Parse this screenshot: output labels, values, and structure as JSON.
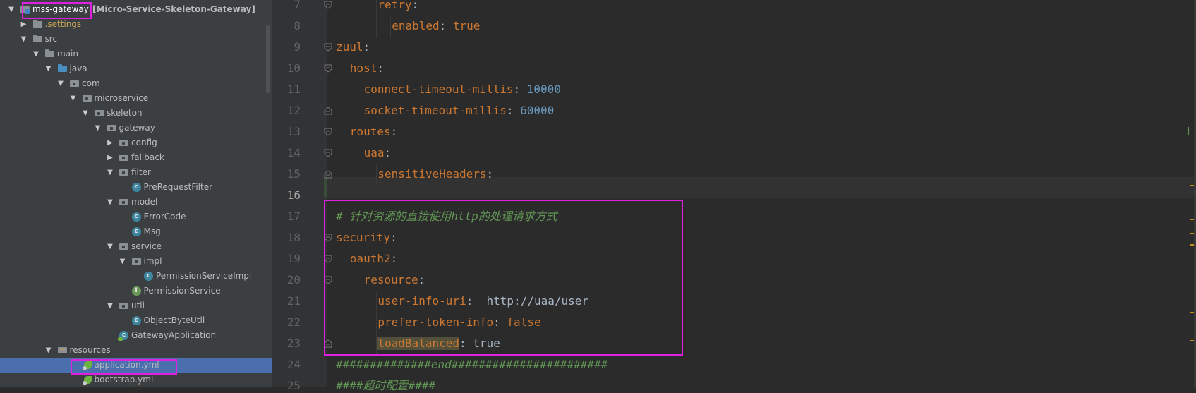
{
  "project_tree": {
    "items": [
      {
        "label": "mss-gateway",
        "suffix": "[Micro-Service-Skeleton-Gateway]",
        "icon": "project-icon",
        "depth": 0,
        "expanded": true
      },
      {
        "label": ".settings",
        "icon": "folder-icon",
        "depth": 1,
        "expanded": false
      },
      {
        "label": "src",
        "icon": "folder-icon",
        "depth": 1,
        "expanded": true
      },
      {
        "label": "main",
        "icon": "folder-icon",
        "depth": 2,
        "expanded": true
      },
      {
        "label": "java",
        "icon": "source-folder-icon",
        "depth": 3,
        "expanded": true
      },
      {
        "label": "com",
        "icon": "package-icon",
        "depth": 4,
        "expanded": true
      },
      {
        "label": "microservice",
        "icon": "package-icon",
        "depth": 5,
        "expanded": true
      },
      {
        "label": "skeleton",
        "icon": "package-icon",
        "depth": 6,
        "expanded": true
      },
      {
        "label": "gateway",
        "icon": "package-icon",
        "depth": 7,
        "expanded": true
      },
      {
        "label": "config",
        "icon": "package-icon",
        "depth": 8,
        "expanded": false
      },
      {
        "label": "fallback",
        "icon": "package-icon",
        "depth": 8,
        "expanded": false
      },
      {
        "label": "filter",
        "icon": "package-icon",
        "depth": 8,
        "expanded": true
      },
      {
        "label": "PreRequestFilter",
        "icon": "class-icon",
        "depth": 9
      },
      {
        "label": "model",
        "icon": "package-icon",
        "depth": 8,
        "expanded": true
      },
      {
        "label": "ErrorCode",
        "icon": "class-icon",
        "depth": 9
      },
      {
        "label": "Msg",
        "icon": "class-icon",
        "depth": 9
      },
      {
        "label": "service",
        "icon": "package-icon",
        "depth": 8,
        "expanded": true
      },
      {
        "label": "impl",
        "icon": "package-icon",
        "depth": 9,
        "expanded": true
      },
      {
        "label": "PermissionServiceImpl",
        "icon": "class-icon",
        "depth": 10
      },
      {
        "label": "PermissionService",
        "icon": "interface-icon",
        "depth": 9
      },
      {
        "label": "util",
        "icon": "package-icon",
        "depth": 8,
        "expanded": true
      },
      {
        "label": "ObjectByteUtil",
        "icon": "class-icon",
        "depth": 9
      },
      {
        "label": "GatewayApplication",
        "icon": "spring-class-icon",
        "depth": 8
      },
      {
        "label": "resources",
        "icon": "resources-folder-icon",
        "depth": 3,
        "expanded": true
      },
      {
        "label": "application.yml",
        "icon": "yaml-file-icon",
        "depth": 5,
        "selected": true
      },
      {
        "label": "bootstrap.yml",
        "icon": "yaml-file-icon",
        "depth": 5
      }
    ]
  },
  "editor": {
    "current_line": "16",
    "lines": [
      {
        "num": "7",
        "tokens": [
          {
            "t": "retry",
            "c": "k"
          },
          {
            "t": ":",
            "c": "p"
          }
        ]
      },
      {
        "num": "8",
        "tokens": [
          {
            "t": "enabled",
            "c": "k"
          },
          {
            "t": ": ",
            "c": "p"
          },
          {
            "t": "true",
            "c": "k"
          }
        ]
      },
      {
        "num": "9",
        "tokens": [
          {
            "t": "zuul",
            "c": "k"
          },
          {
            "t": ":",
            "c": "p"
          }
        ]
      },
      {
        "num": "10",
        "tokens": [
          {
            "t": "host",
            "c": "k"
          },
          {
            "t": ":",
            "c": "p"
          }
        ]
      },
      {
        "num": "11",
        "tokens": [
          {
            "t": "connect-timeout-millis",
            "c": "k"
          },
          {
            "t": ": ",
            "c": "p"
          },
          {
            "t": "10000",
            "c": "n"
          }
        ]
      },
      {
        "num": "12",
        "tokens": [
          {
            "t": "socket-timeout-millis",
            "c": "k"
          },
          {
            "t": ": ",
            "c": "p"
          },
          {
            "t": "60000",
            "c": "n"
          }
        ]
      },
      {
        "num": "13",
        "tokens": [
          {
            "t": "routes",
            "c": "k"
          },
          {
            "t": ":",
            "c": "p"
          }
        ]
      },
      {
        "num": "14",
        "tokens": [
          {
            "t": "uaa",
            "c": "k"
          },
          {
            "t": ":",
            "c": "p"
          }
        ]
      },
      {
        "num": "15",
        "tokens": [
          {
            "t": "sensitiveHeaders",
            "c": "k"
          },
          {
            "t": ":",
            "c": "p"
          }
        ]
      },
      {
        "num": "16",
        "tokens": []
      },
      {
        "num": "17",
        "tokens": [
          {
            "t": "# 针对资源的直接使用http的处理请求方式",
            "c": "c"
          }
        ]
      },
      {
        "num": "18",
        "tokens": [
          {
            "t": "security",
            "c": "k"
          },
          {
            "t": ":",
            "c": "p"
          }
        ]
      },
      {
        "num": "19",
        "tokens": [
          {
            "t": "oauth2",
            "c": "k"
          },
          {
            "t": ":",
            "c": "p"
          }
        ]
      },
      {
        "num": "20",
        "tokens": [
          {
            "t": "resource",
            "c": "k"
          },
          {
            "t": ":",
            "c": "p"
          }
        ]
      },
      {
        "num": "21",
        "tokens": [
          {
            "t": "user-info-uri",
            "c": "k"
          },
          {
            "t": ":  http://uaa/user",
            "c": "p"
          }
        ]
      },
      {
        "num": "22",
        "tokens": [
          {
            "t": "prefer-token-info",
            "c": "k"
          },
          {
            "t": ": ",
            "c": "p"
          },
          {
            "t": "false",
            "c": "k"
          }
        ]
      },
      {
        "num": "23",
        "tokens": [
          {
            "t": "loadBalanced",
            "c": "k hl"
          },
          {
            "t": ": true",
            "c": "p"
          }
        ]
      },
      {
        "num": "24",
        "tokens": [
          {
            "t": "##############end#######################",
            "c": "c"
          }
        ]
      },
      {
        "num": "25",
        "tokens": [
          {
            "t": "####超时配置####",
            "c": "c"
          }
        ]
      }
    ]
  },
  "colors": {
    "keyword": "#cc7832",
    "number": "#6897bb",
    "comment": "#629755",
    "plain": "#a9b7c6",
    "annotation_box": "#e020e0",
    "selection": "#4b6eaf"
  }
}
